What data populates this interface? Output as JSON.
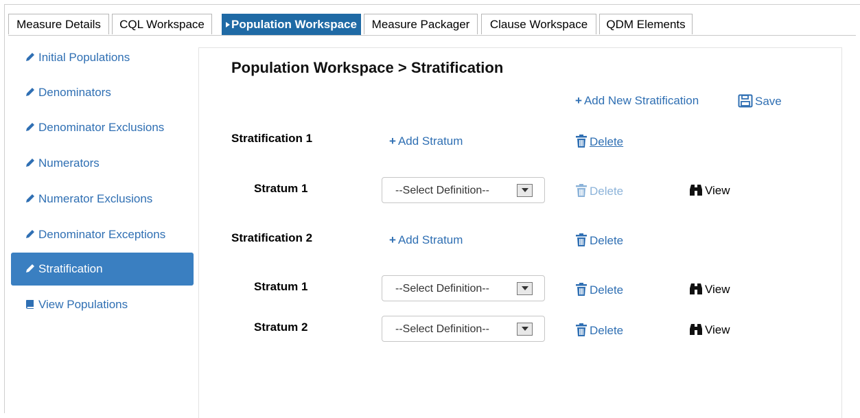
{
  "tabs": [
    {
      "label": "Measure Details",
      "active": false
    },
    {
      "label": "CQL Workspace",
      "active": false
    },
    {
      "label": "Population Workspace",
      "active": true
    },
    {
      "label": "Measure Packager",
      "active": false
    },
    {
      "label": "Clause Workspace",
      "active": false
    },
    {
      "label": "QDM Elements",
      "active": false
    }
  ],
  "sidebar": {
    "items": [
      {
        "label": "Initial Populations",
        "icon": "pencil-icon"
      },
      {
        "label": "Denominators",
        "icon": "pencil-icon"
      },
      {
        "label": "Denominator Exclusions",
        "icon": "pencil-icon"
      },
      {
        "label": "Numerators",
        "icon": "pencil-icon"
      },
      {
        "label": "Numerator Exclusions",
        "icon": "pencil-icon"
      },
      {
        "label": "Denominator Exceptions",
        "icon": "pencil-icon"
      },
      {
        "label": "Stratification",
        "icon": "pencil-icon",
        "active": true
      },
      {
        "label": "View Populations",
        "icon": "book-icon"
      }
    ]
  },
  "main": {
    "title": "Population Workspace > Stratification",
    "add_new_stratification": "Add New Stratification",
    "save": "Save",
    "stratifications": [
      {
        "label": "Stratification 1",
        "add_stratum": "Add Stratum",
        "delete": "Delete",
        "strata": [
          {
            "label": "Stratum 1",
            "select": "--Select Definition--",
            "delete": "Delete",
            "delete_disabled": true,
            "view": "View"
          }
        ]
      },
      {
        "label": "Stratification 2",
        "add_stratum": "Add Stratum",
        "delete": "Delete",
        "strata": [
          {
            "label": "Stratum 1",
            "select": "--Select Definition--",
            "delete": "Delete",
            "delete_disabled": false,
            "view": "View"
          },
          {
            "label": "Stratum 2",
            "select": "--Select Definition--",
            "delete": "Delete",
            "delete_disabled": false,
            "view": "View"
          }
        ]
      }
    ]
  },
  "colors": {
    "accent": "#1f6aa5",
    "link": "#2f6fb3",
    "sidebar_active": "#3a7fc1",
    "disabled_link": "#8cb3d9"
  }
}
